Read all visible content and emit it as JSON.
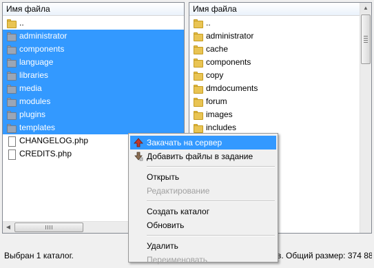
{
  "left_panel": {
    "column_header": "Имя файла",
    "items": [
      {
        "name": "..",
        "type": "folder-yellow",
        "selected": false
      },
      {
        "name": "administrator",
        "type": "folder-grey",
        "selected": true
      },
      {
        "name": "components",
        "type": "folder-grey",
        "selected": true
      },
      {
        "name": "language",
        "type": "folder-grey",
        "selected": true
      },
      {
        "name": "libraries",
        "type": "folder-grey",
        "selected": true
      },
      {
        "name": "media",
        "type": "folder-grey",
        "selected": true
      },
      {
        "name": "modules",
        "type": "folder-grey",
        "selected": true
      },
      {
        "name": "plugins",
        "type": "folder-grey",
        "selected": true
      },
      {
        "name": "templates",
        "type": "folder-grey",
        "selected": true
      },
      {
        "name": "CHANGELOG.php",
        "type": "file",
        "selected": false
      },
      {
        "name": "CREDITS.php",
        "type": "file",
        "selected": false
      }
    ],
    "status": "Выбран 1 каталог."
  },
  "right_panel": {
    "column_header": "Имя файла",
    "items": [
      {
        "name": "..",
        "type": "folder-yellow"
      },
      {
        "name": "administrator",
        "type": "folder-yellow"
      },
      {
        "name": "cache",
        "type": "folder-yellow"
      },
      {
        "name": "components",
        "type": "folder-yellow"
      },
      {
        "name": "copy",
        "type": "folder-yellow"
      },
      {
        "name": "dmdocuments",
        "type": "folder-yellow"
      },
      {
        "name": "forum",
        "type": "folder-yellow"
      },
      {
        "name": "images",
        "type": "folder-yellow"
      },
      {
        "name": "includes",
        "type": "folder-yellow"
      }
    ],
    "status": "в. Общий размер: 374 88"
  },
  "context_menu": {
    "items": [
      {
        "label": "Закачать на сервер",
        "icon": "upload-arrow-icon",
        "highlighted": true,
        "disabled": false
      },
      {
        "label": "Добавить файлы в задание",
        "icon": "add-to-queue-icon",
        "highlighted": false,
        "disabled": false
      },
      {
        "separator": true
      },
      {
        "label": "Открыть",
        "highlighted": false,
        "disabled": false
      },
      {
        "label": "Редактирование",
        "highlighted": false,
        "disabled": true
      },
      {
        "separator": true
      },
      {
        "label": "Создать каталог",
        "highlighted": false,
        "disabled": false
      },
      {
        "label": "Обновить",
        "highlighted": false,
        "disabled": false
      },
      {
        "separator": true
      },
      {
        "label": "Удалить",
        "highlighted": false,
        "disabled": false
      },
      {
        "label": "Переименовать",
        "highlighted": false,
        "disabled": true
      }
    ]
  },
  "colors": {
    "selection": "#3399ff",
    "folder_yellow": "#e9c453",
    "folder_grey": "#9aa6b7",
    "disabled_text": "#a0a0a0"
  }
}
